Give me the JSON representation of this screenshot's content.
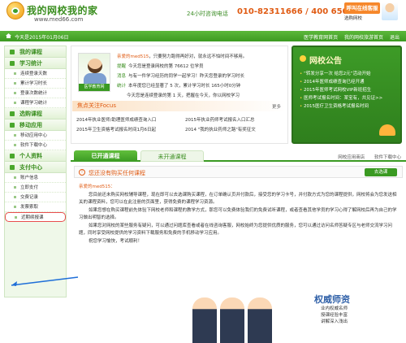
{
  "header": {
    "logo_text": "我的网校我的家",
    "logo_url": "www.med66.com",
    "hotline_label": "24小时咨询电话",
    "hotline": "010-82311666 / 400 650 1888",
    "online_service": "呼叫在线客服",
    "online_service_sub": "选购网校"
  },
  "nav": {
    "date": "今天是2015年01月06日",
    "links": [
      "医学教育网首页",
      "我的网校旅游首页",
      "退出"
    ]
  },
  "sidebar": {
    "sections": [
      {
        "title": "我的课程",
        "items": []
      },
      {
        "title": "学习统计",
        "items": [
          "连续登录天数",
          "累计学习时长",
          "登录次数统计",
          "课程学习统计"
        ]
      },
      {
        "title": "选购课程",
        "items": []
      },
      {
        "title": "移动应用",
        "items": [
          "移动应用中心",
          "软件下载中心"
        ]
      },
      {
        "title": "个人资料",
        "items": []
      },
      {
        "title": "支付中心",
        "items": [
          "账户信息",
          "立即支付",
          "交费记录",
          "发票索取",
          "近期续报课"
        ]
      }
    ],
    "highlighted_item": "近期续报课"
  },
  "welcome": {
    "greeting_name": "亲爱的med515",
    "greeting_text": "，只要努力跑得再好对，就永远不怕时间不够用。",
    "lines": [
      {
        "tag": "提醒",
        "text": "今天您是登录网校的第 76612 位学员"
      },
      {
        "tag": "消息",
        "text": "与有一件学习经历的同学一起学习！昨天您登录的学习时长"
      },
      {
        "tag": "统计",
        "text": "本年度您已经显著了 5 次，累计学习时长 165小时0分钟"
      },
      {
        "tag": "",
        "text": "今天您是连续登录的第 1 天，把握在今天，你以网校学习"
      }
    ],
    "avatar_caption": "医学教育网",
    "focus_title": "焦点关注Focus",
    "focus_more": "更多",
    "news": [
      "2014年执业医师/助理医师成绩查询入口",
      "2015年卫生资格考试报名时间1月6日起",
      "2015年执业药师考试报名入口汇总",
      "2014 \"我的执业药师之路\"有奖征文"
    ]
  },
  "notice": {
    "title": "网校公告",
    "items": [
      "“转发分享一次 给您2元”活动开始",
      "2014年医师成绩查询已经开通",
      "2015年医师考试网校VIP新班招生",
      "医师考试报名时间：某宝有，共见证>>",
      "2015医疗卫生资格考试报名时间"
    ]
  },
  "tabs": {
    "active": "已开通课程",
    "inactive": "未开通课程",
    "extras": [
      "网校应用商店",
      "软件下载中心"
    ]
  },
  "message": {
    "text": "您还没有购买任何课程",
    "button": "去选课"
  },
  "letter": {
    "salute": "亲爱的med515：",
    "p1": "您目前还未购买网校辅导课程，现在即可以去选课购买课程，在订单确认页并付款后，接受您的学习卡号，并付款方式为您的课程提供，网校将会为您发送相关的课程资料，您可以在此注册的页面里，获得免费的课程学习资源。",
    "p2": "如果您想在购买课程前先体验下网校老师和课程的教学方式，那您可以免费体验我们的免费试听课程，或者查看其他学员的学习心得了解网校后再为自己的学习做出明智的选择。",
    "p3": "如果您对网校的某些服务有疑问，可以通过问题库查看或者在线咨询客服，网校始终为您提供优质的服务，您可以通过访问名师答疑专区与老师交流学习问题，同时享受网校提供的学习资料下载服务和免费的手机移动学习应用。",
    "p4": "祝您学习愉快，考试顺利！"
  },
  "bottom_banner": {
    "title": "权威师资",
    "subtitle": "业内权威名师",
    "subtitle2": "授课经验丰富",
    "subtitle3": "讲解深入浅出"
  }
}
